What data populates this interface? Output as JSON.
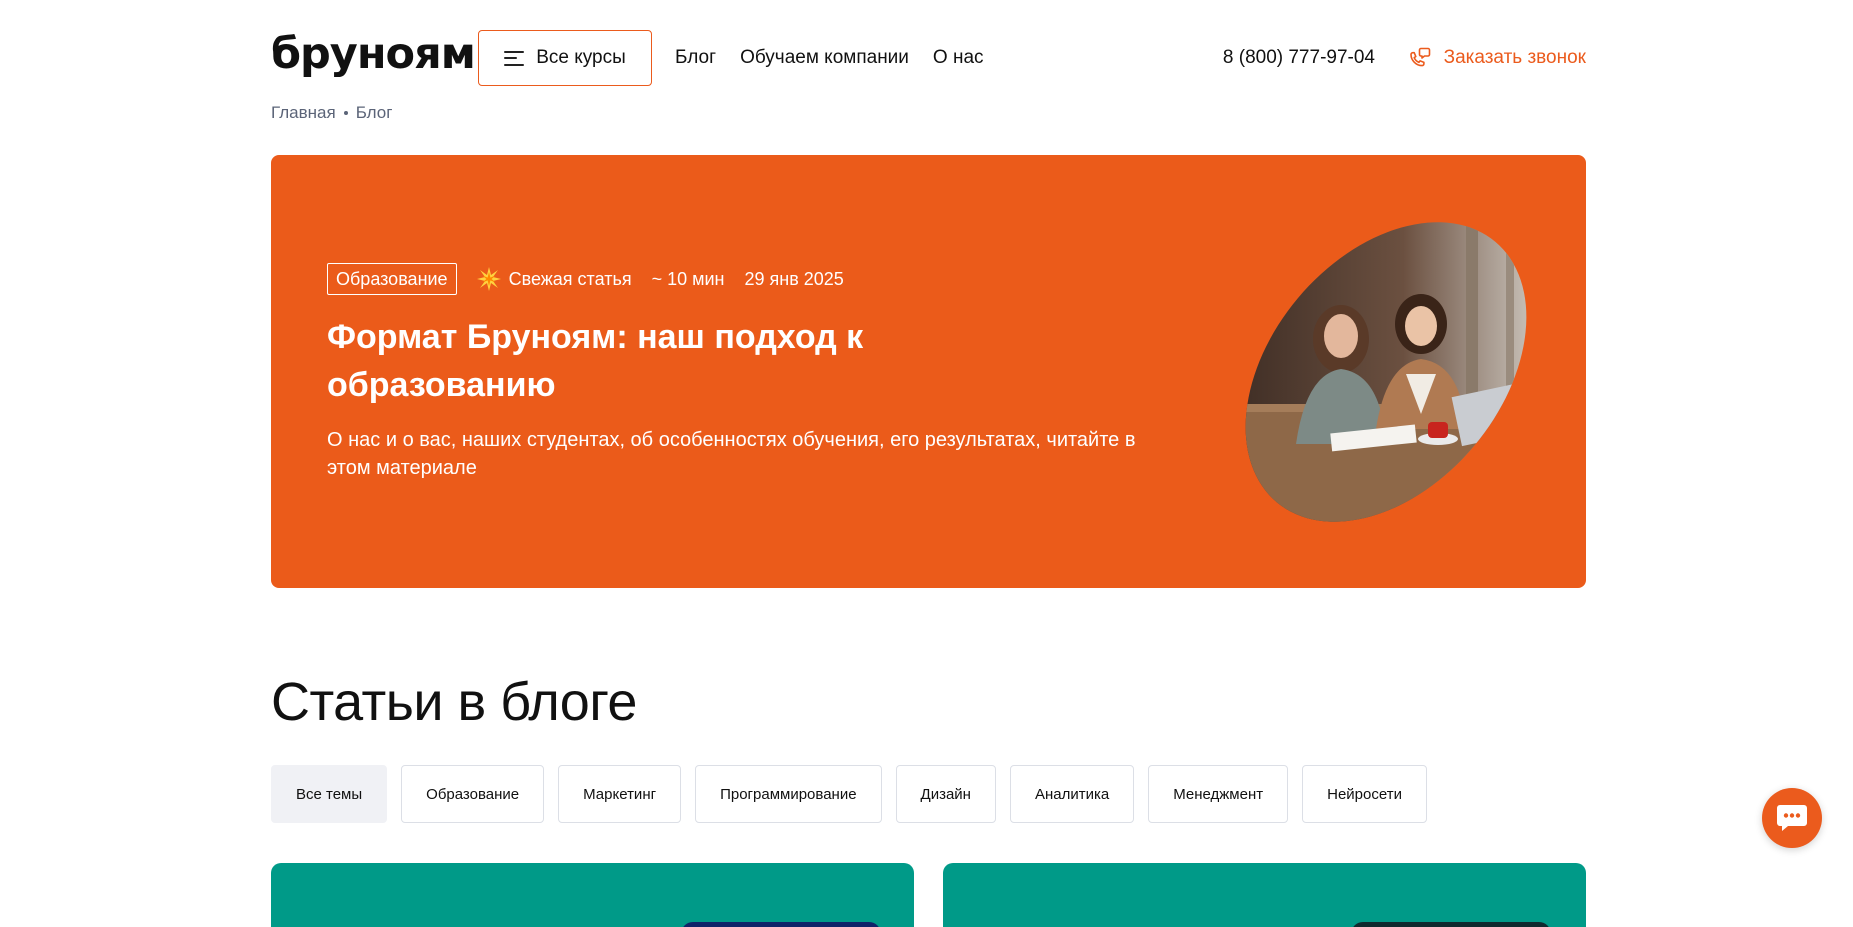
{
  "header": {
    "logo": "бруноям",
    "courses_label": "Все курсы",
    "nav": [
      {
        "label": "Блог"
      },
      {
        "label": "Обучаем компании"
      },
      {
        "label": "О нас"
      }
    ],
    "phone": "8 (800) 777-97-04",
    "callback_label": "Заказать звонок"
  },
  "breadcrumb": {
    "home": "Главная",
    "current": "Блог"
  },
  "hero": {
    "tag": "Образование",
    "fresh_label": "Свежая статья",
    "read_time": "~ 10 мин",
    "date": "29 янв 2025",
    "title": "Формат Бруноям: наш подход к образованию",
    "description": "О нас и о вас, наших студентах, об особенностях обучения, его результатах, читайте в этом материале"
  },
  "blog": {
    "title": "Статьи в блоге",
    "filters": [
      {
        "label": "Все темы",
        "active": true
      },
      {
        "label": "Образование"
      },
      {
        "label": "Маркетинг"
      },
      {
        "label": "Программирование"
      },
      {
        "label": "Дизайн"
      },
      {
        "label": "Аналитика"
      },
      {
        "label": "Менеджмент"
      },
      {
        "label": "Нейросети"
      }
    ]
  },
  "colors": {
    "accent": "#eb5b1d",
    "card": "#009a88",
    "breadcrumb": "#5b6478"
  },
  "icons": {
    "burger": "burger-icon",
    "callback": "phone-chat-icon",
    "fresh": "spark-icon",
    "chat": "chat-icon"
  }
}
